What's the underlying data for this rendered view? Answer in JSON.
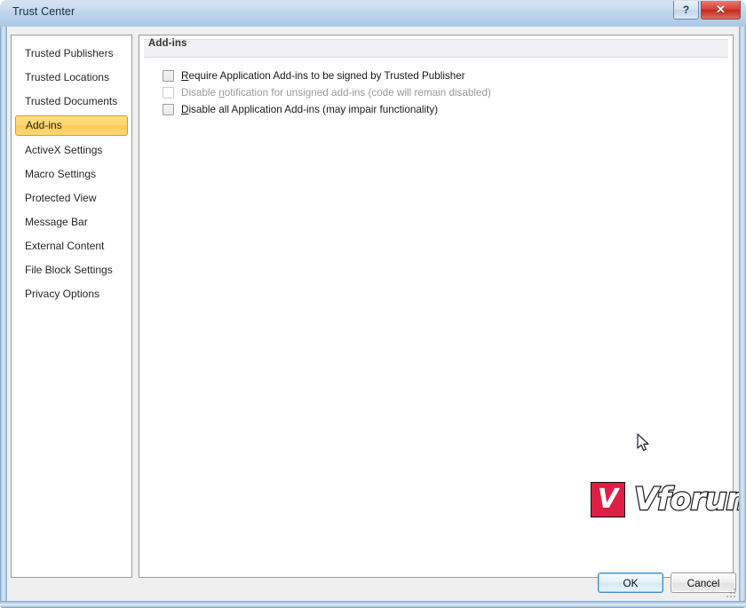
{
  "window": {
    "title": "Trust Center",
    "help_button_label": "?",
    "close_button_label": "✕"
  },
  "sidebar": {
    "items": [
      {
        "label": "Trusted Publishers",
        "selected": false
      },
      {
        "label": "Trusted Locations",
        "selected": false
      },
      {
        "label": "Trusted Documents",
        "selected": false
      },
      {
        "label": "Add-ins",
        "selected": true
      },
      {
        "label": "ActiveX Settings",
        "selected": false
      },
      {
        "label": "Macro Settings",
        "selected": false
      },
      {
        "label": "Protected View",
        "selected": false
      },
      {
        "label": "Message Bar",
        "selected": false
      },
      {
        "label": "External Content",
        "selected": false
      },
      {
        "label": "File Block Settings",
        "selected": false
      },
      {
        "label": "Privacy Options",
        "selected": false
      }
    ]
  },
  "content": {
    "header_title": "Add-ins",
    "options": [
      {
        "accel": "R",
        "label_rest": "equire Application Add-ins to be signed by Trusted Publisher",
        "checked": false,
        "disabled": false
      },
      {
        "label_pre": "Disable ",
        "accel": "n",
        "label_rest": "otification for unsigned add-ins (code will remain disabled)",
        "checked": false,
        "disabled": true
      },
      {
        "accel": "D",
        "label_rest": "isable all Application Add-ins (may impair functionality)",
        "checked": false,
        "disabled": false
      }
    ]
  },
  "watermark": {
    "mark_letter": "V",
    "text": "Vforum.vn",
    "mark_color": "#e01e45"
  },
  "footer": {
    "ok_label": "OK",
    "cancel_label": "Cancel"
  }
}
